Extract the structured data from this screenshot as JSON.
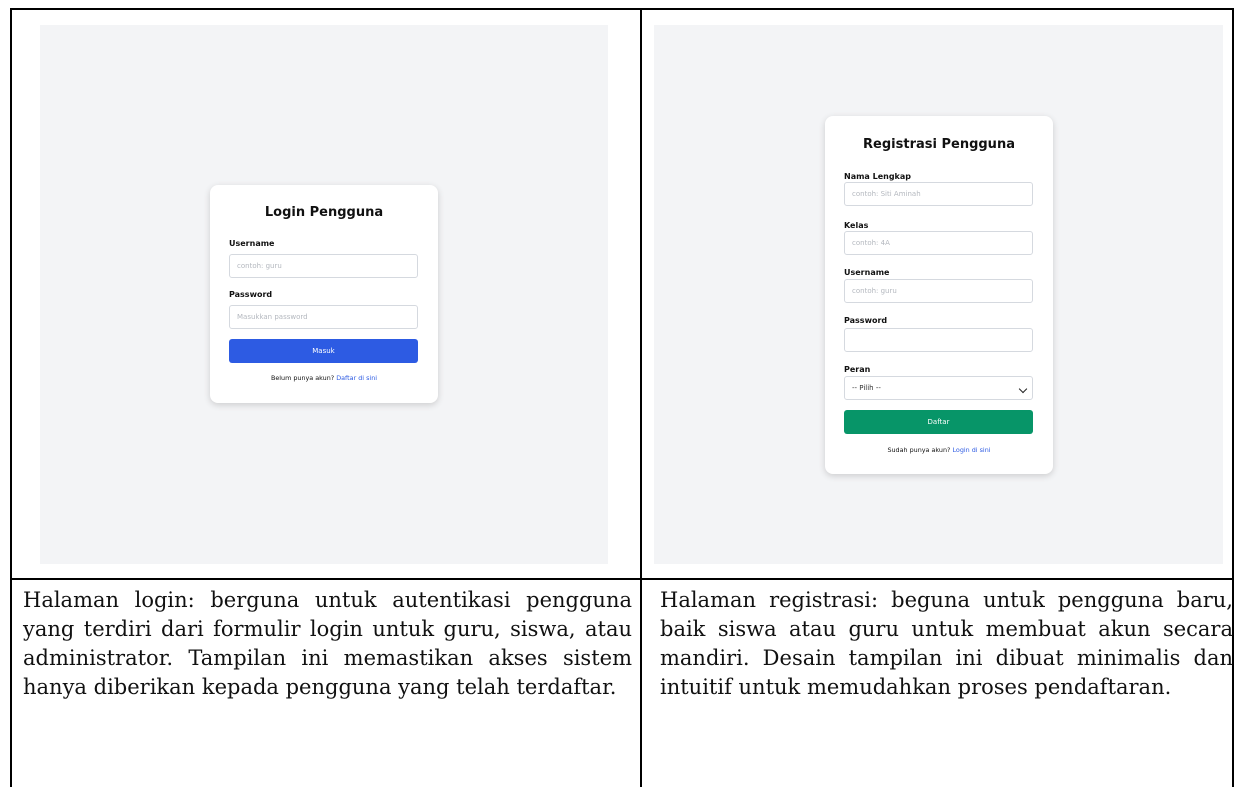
{
  "left_panel": {
    "card_title": "Login Pengguna",
    "fields": [
      {
        "label": "Username",
        "placeholder": "contoh: guru"
      },
      {
        "label": "Password",
        "placeholder": "Masukkan password"
      }
    ],
    "button_label": "Masuk",
    "helper_text": "Belum punya akun?",
    "helper_link": "Daftar di sini",
    "caption": "Halaman login: berguna untuk autentikasi pengguna yang terdiri dari formulir login untuk guru, siswa, atau administrator. Tampilan ini memastikan akses sistem hanya diberikan kepada pengguna yang telah terdaftar."
  },
  "right_panel": {
    "card_title": "Registrasi Pengguna",
    "fields": [
      {
        "label": "Nama Lengkap",
        "placeholder": "contoh: Siti Aminah"
      },
      {
        "label": "Kelas",
        "placeholder": "contoh: 4A"
      },
      {
        "label": "Username",
        "placeholder": "contoh: guru"
      },
      {
        "label": "Password",
        "placeholder": ""
      }
    ],
    "role_label": "Peran",
    "role_selected": "-- Pilih --",
    "button_label": "Daftar",
    "helper_text": "Sudah punya akun?",
    "helper_link": "Login di sini",
    "caption": "Halaman registrasi: beguna untuk pengguna baru, baik siswa atau guru untuk membuat akun secara mandiri. Desain tampilan ini dibuat minimalis dan intuitif untuk memudahkan proses pendaftaran."
  },
  "colors": {
    "screenshot_background": "#f3f4f6",
    "login_button": "#2d5be3",
    "register_button": "#079568",
    "link": "#2d5be3",
    "table_border": "#000000"
  }
}
